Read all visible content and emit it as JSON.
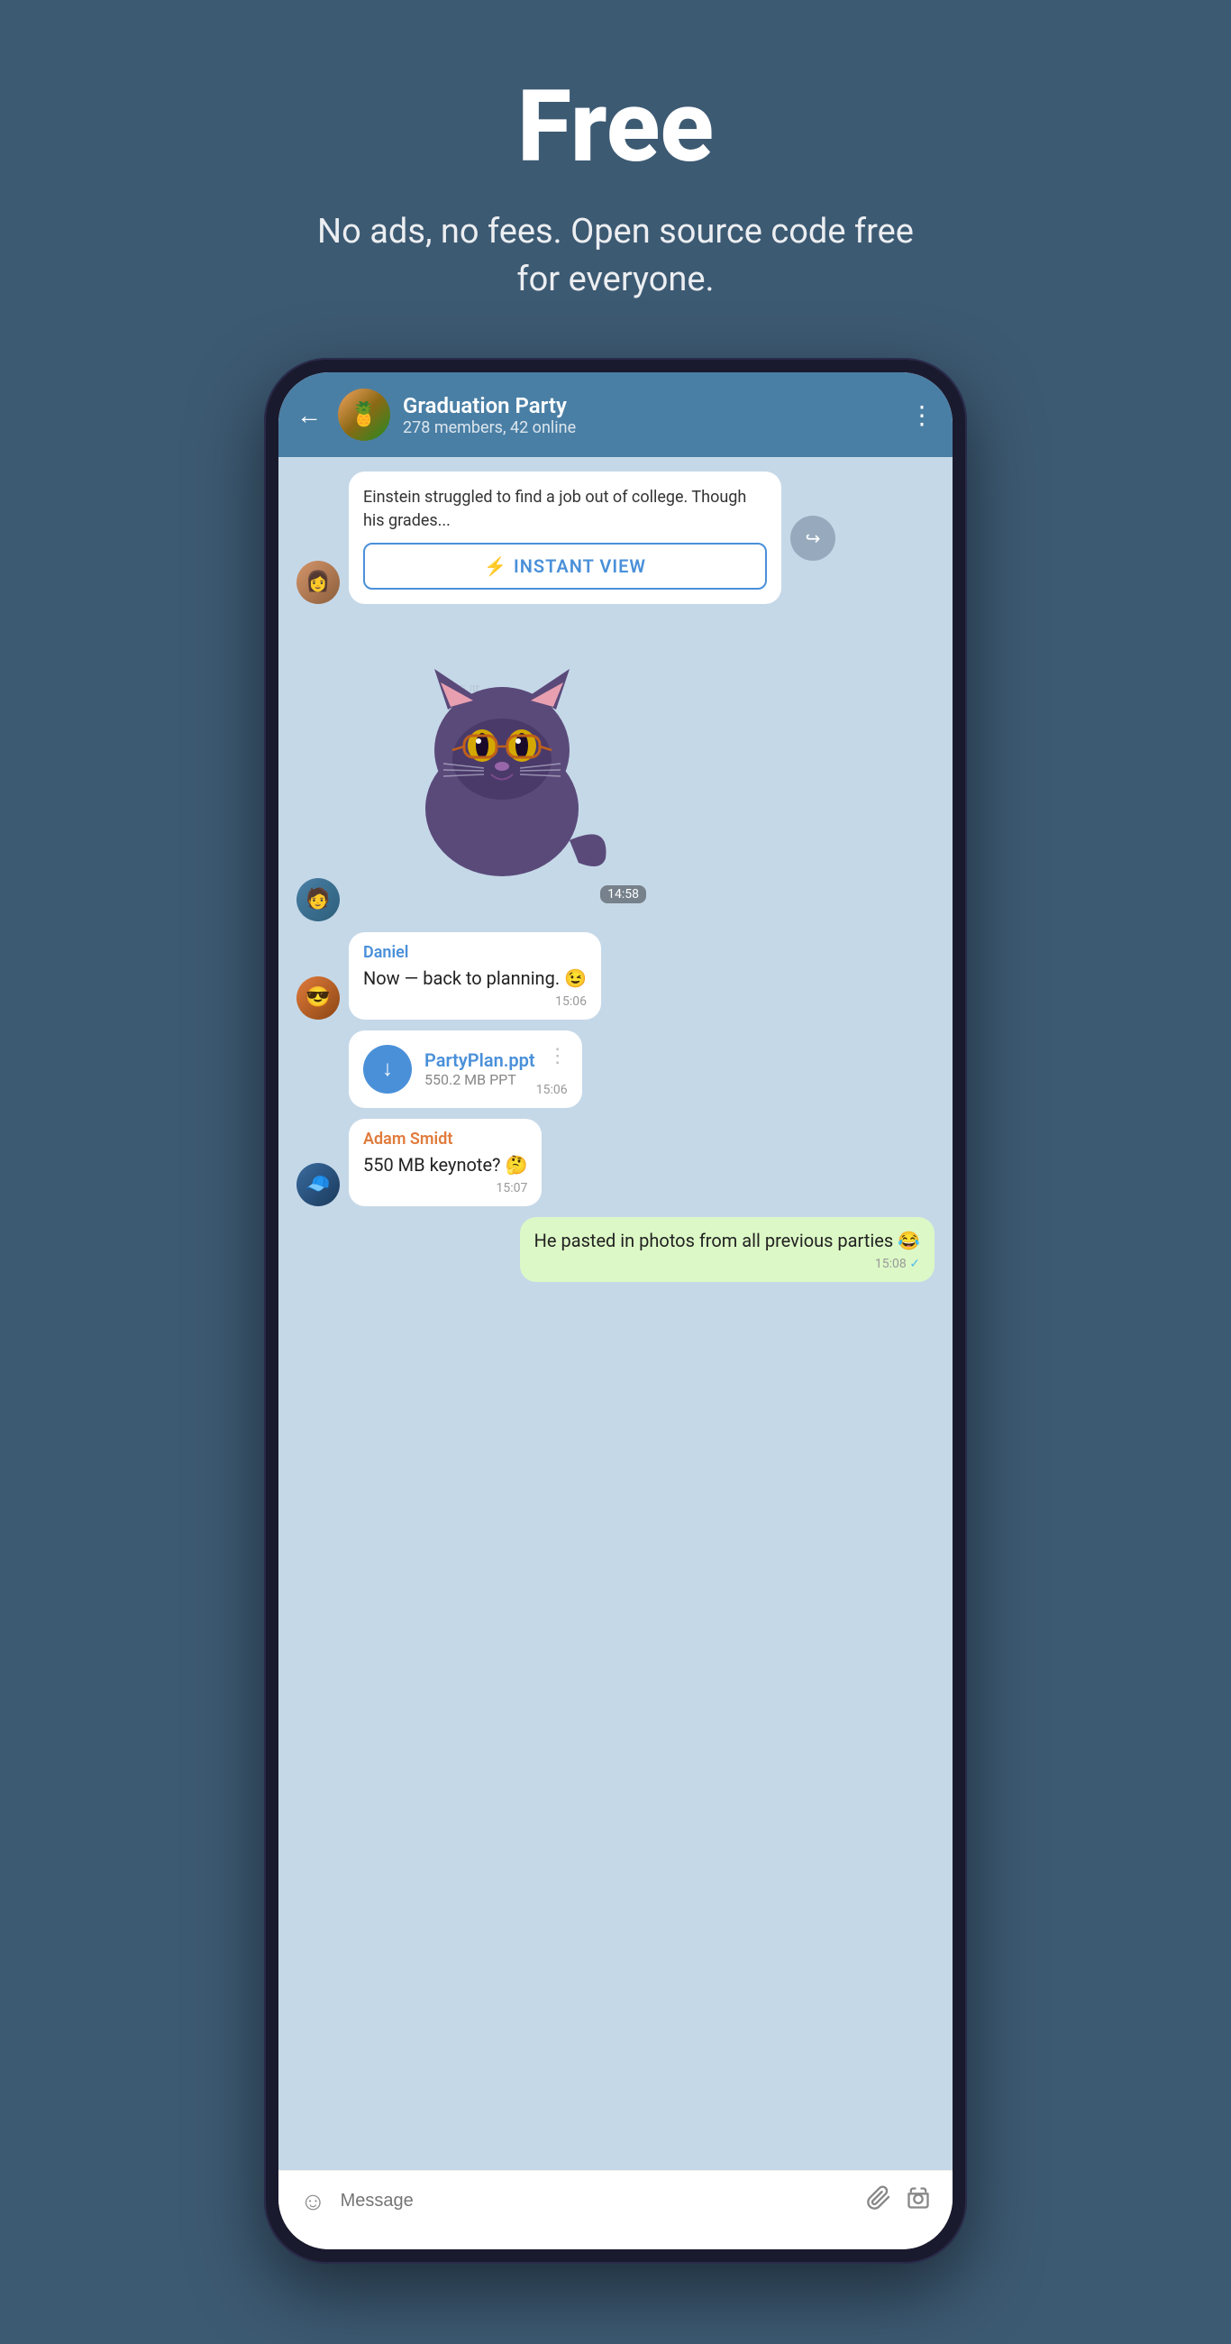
{
  "hero": {
    "title": "Free",
    "subtitle": "No ads, no fees. Open source code free for everyone."
  },
  "phone": {
    "header": {
      "back_label": "←",
      "group_name": "Graduation Party",
      "members_info": "278 members, 42 online",
      "menu_icon": "⋮",
      "group_emoji": "🍍"
    },
    "messages": [
      {
        "id": "article-preview",
        "type": "article",
        "text": "Einstein struggled to find a job out of college. Though his grades...",
        "instant_view_label": "INSTANT VIEW",
        "time": null
      },
      {
        "id": "sticker-msg",
        "type": "sticker",
        "time": "14:58"
      },
      {
        "id": "daniel-msg",
        "sender": "Daniel",
        "text": "Now — back to planning. 😉",
        "time": "15:06",
        "type": "incoming"
      },
      {
        "id": "file-msg",
        "type": "file",
        "file_name": "PartyPlan.ppt",
        "file_size": "550.2 MB PPT",
        "time": "15:06"
      },
      {
        "id": "adam-msg",
        "sender": "Adam Smidt",
        "text": "550 MB keynote? 🤔",
        "time": "15:07",
        "type": "incoming"
      },
      {
        "id": "outgoing-msg",
        "text": "He pasted in photos from all previous parties 😂",
        "time": "15:08",
        "type": "outgoing"
      }
    ],
    "input_bar": {
      "placeholder": "Message",
      "emoji_icon": "☺",
      "attach_icon": "📎",
      "camera_icon": "⊙"
    }
  }
}
